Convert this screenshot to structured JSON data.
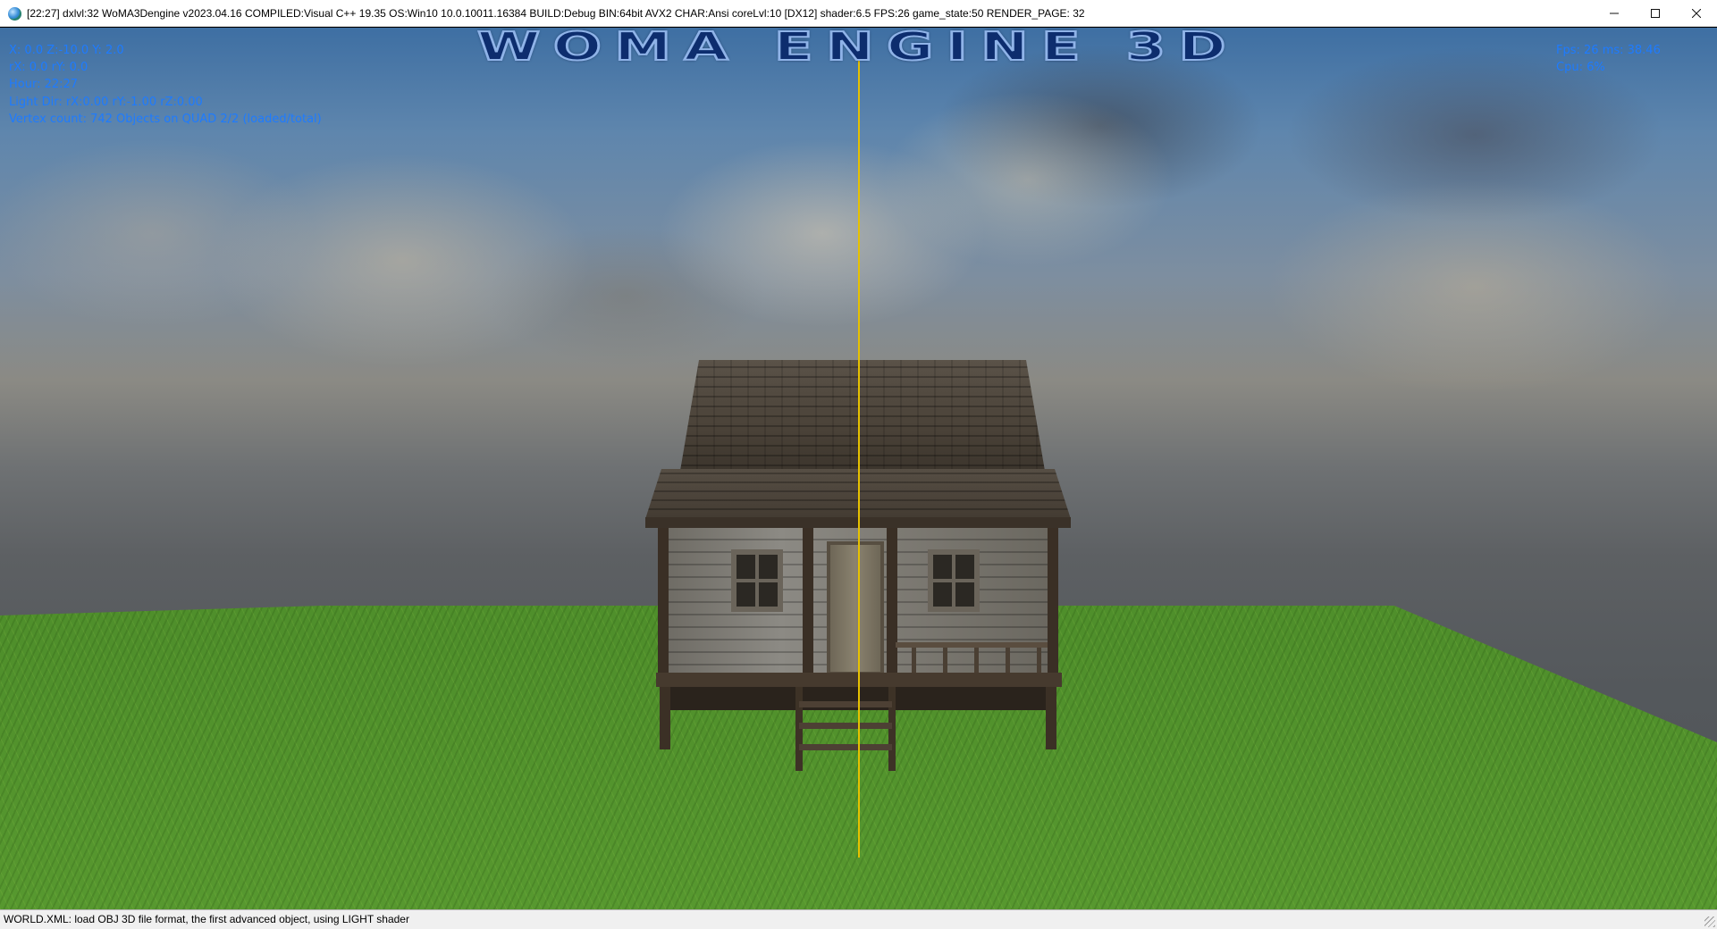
{
  "window": {
    "title": "[22:27] dxlvl:32 WoMA3Dengine v2023.04.16 COMPILED:Visual C++ 19.35 OS:Win10 10.0.10011.16384 BUILD:Debug BIN:64bit AVX2 CHAR:Ansi coreLvl:10 [DX12] shader:6.5 FPS:26 game_state:50 RENDER_PAGE: 32",
    "app_icon": "globe-icon",
    "controls": [
      "minimize-icon",
      "maximize-icon",
      "close-icon"
    ]
  },
  "hud": {
    "logo": "WOMA ENGINE 3D",
    "left_lines": [
      "X: 0.0 Z:-10.0 Y: 2.0",
      "rX: 0.0 rY: 0.0",
      "Hour: 22:27",
      "Light Dir: rX:0.00 rY:-1.00 rZ:0.00",
      "Vertex count: 742 Objects on QUAD 2/2 (loaded/total)"
    ],
    "right_lines": [
      "Fps: 26   ms: 38.46",
      "Cpu: 6%"
    ],
    "text_color": "#1e7bff"
  },
  "scene": {
    "description_colors": {
      "grass": "#4f8f2b",
      "crosshair": "#e6c100"
    }
  },
  "status_bar": {
    "text": "WORLD.XML: load OBJ 3D file format, the first advanced object, using LIGHT shader"
  }
}
